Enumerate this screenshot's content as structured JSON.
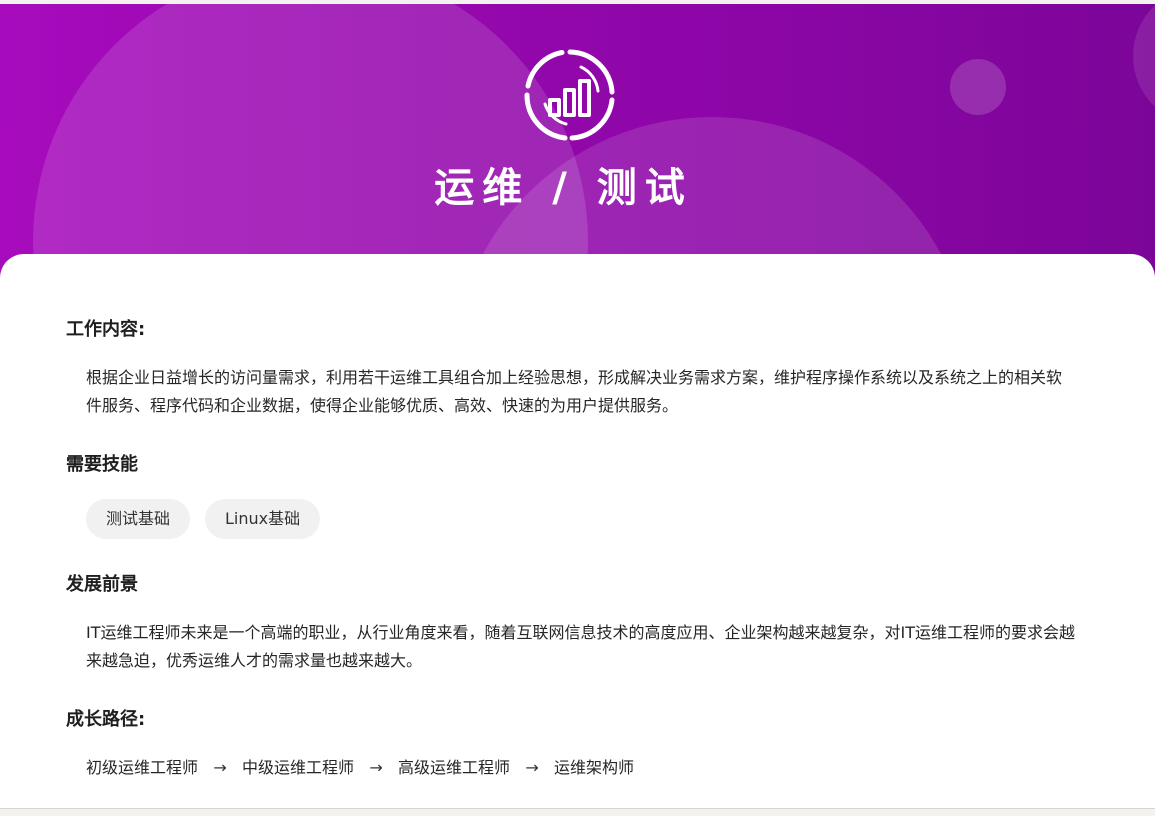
{
  "hero": {
    "icon": "bar-chart-gauge-icon",
    "title": "运维 / 测试",
    "colors": {
      "gradient_start": "#a70bbd",
      "gradient_end": "#7c0599"
    }
  },
  "sections": {
    "job": {
      "title": "工作内容:",
      "text": "根据企业日益增长的访问量需求，利用若干运维工具组合加上经验思想，形成解决业务需求方案，维护程序操作系统以及系统之上的相关软件服务、程序代码和企业数据，使得企业能够优质、高效、快速的为用户提供服务。"
    },
    "skills": {
      "title": "需要技能",
      "items": [
        "测试基础",
        "Linux基础"
      ]
    },
    "prospects": {
      "title": "发展前景",
      "text": "IT运维工程师未来是一个高端的职业，从行业角度来看，随着互联网信息技术的高度应用、企业架构越来越复杂，对IT运维工程师的要求会越来越急迫，优秀运维人才的需求量也越来越大。"
    },
    "growth": {
      "title": "成长路径:",
      "steps": [
        "初级运维工程师",
        "中级运维工程师",
        "高级运维工程师",
        "运维架构师"
      ],
      "arrow": "→"
    }
  }
}
